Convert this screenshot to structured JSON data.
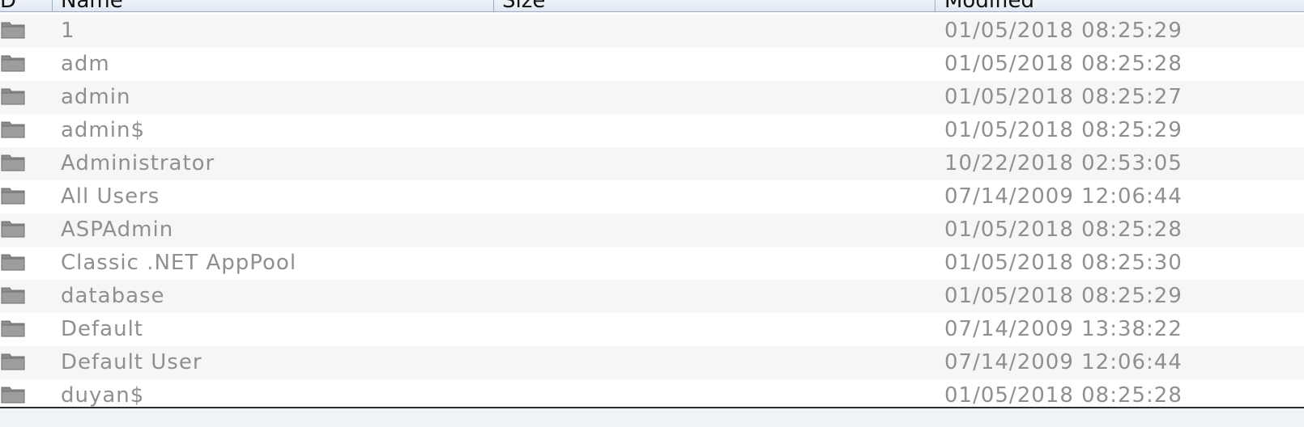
{
  "columns": {
    "d": "D",
    "name": "Name",
    "size": "Size",
    "modified": "Modified"
  },
  "rows": [
    {
      "icon": "folder-icon",
      "name": "1",
      "size": "",
      "modified": "01/05/2018 08:25:29"
    },
    {
      "icon": "folder-icon",
      "name": "adm",
      "size": "",
      "modified": "01/05/2018 08:25:28"
    },
    {
      "icon": "folder-icon",
      "name": "admin",
      "size": "",
      "modified": "01/05/2018 08:25:27"
    },
    {
      "icon": "folder-icon",
      "name": "admin$",
      "size": "",
      "modified": "01/05/2018 08:25:29"
    },
    {
      "icon": "folder-icon",
      "name": "Administrator",
      "size": "",
      "modified": "10/22/2018 02:53:05"
    },
    {
      "icon": "folder-icon",
      "name": "All Users",
      "size": "",
      "modified": "07/14/2009 12:06:44"
    },
    {
      "icon": "folder-icon",
      "name": "ASPAdmin",
      "size": "",
      "modified": "01/05/2018 08:25:28"
    },
    {
      "icon": "folder-icon",
      "name": "Classic .NET AppPool",
      "size": "",
      "modified": "01/05/2018 08:25:30"
    },
    {
      "icon": "folder-icon",
      "name": "database",
      "size": "",
      "modified": "01/05/2018 08:25:29"
    },
    {
      "icon": "folder-icon",
      "name": "Default",
      "size": "",
      "modified": "07/14/2009 13:38:22"
    },
    {
      "icon": "folder-icon",
      "name": "Default User",
      "size": "",
      "modified": "07/14/2009 12:06:44"
    },
    {
      "icon": "folder-icon",
      "name": "duyan$",
      "size": "",
      "modified": "01/05/2018 08:25:28"
    }
  ],
  "colors": {
    "text_muted": "#8f8f8f",
    "header_bg": "#dfe8f1",
    "row_alt": "#f5f6f8"
  }
}
